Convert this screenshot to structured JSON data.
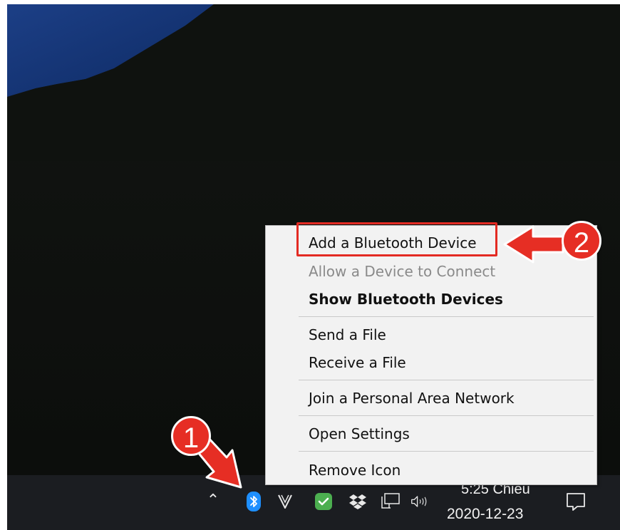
{
  "context_menu": {
    "items": [
      {
        "label": "Add a Bluetooth Device",
        "state": "normal"
      },
      {
        "label": "Allow a Device to Connect",
        "state": "disabled"
      },
      {
        "label": "Show Bluetooth Devices",
        "state": "bold"
      },
      {
        "label": "Send a File",
        "state": "normal"
      },
      {
        "label": "Receive a File",
        "state": "normal"
      },
      {
        "label": "Join a Personal Area Network",
        "state": "normal"
      },
      {
        "label": "Open Settings",
        "state": "normal"
      },
      {
        "label": "Remove Icon",
        "state": "normal"
      }
    ]
  },
  "taskbar": {
    "tray_icons": [
      "chevron-up-icon",
      "bluetooth-icon",
      "vivaldi-icon",
      "green-check-icon",
      "dropbox-icon",
      "network-icon",
      "volume-icon"
    ],
    "clock_time": "5:25 Chiều",
    "clock_date": "2020-12-23"
  },
  "annotations": {
    "step1": "1",
    "step2": "2"
  },
  "colors": {
    "annotation_red": "#e32b23",
    "bluetooth_blue": "#1e8fff",
    "check_green": "#4caf50",
    "taskbar_bg": "#1b1d21",
    "menu_bg": "#f2f2f2"
  }
}
